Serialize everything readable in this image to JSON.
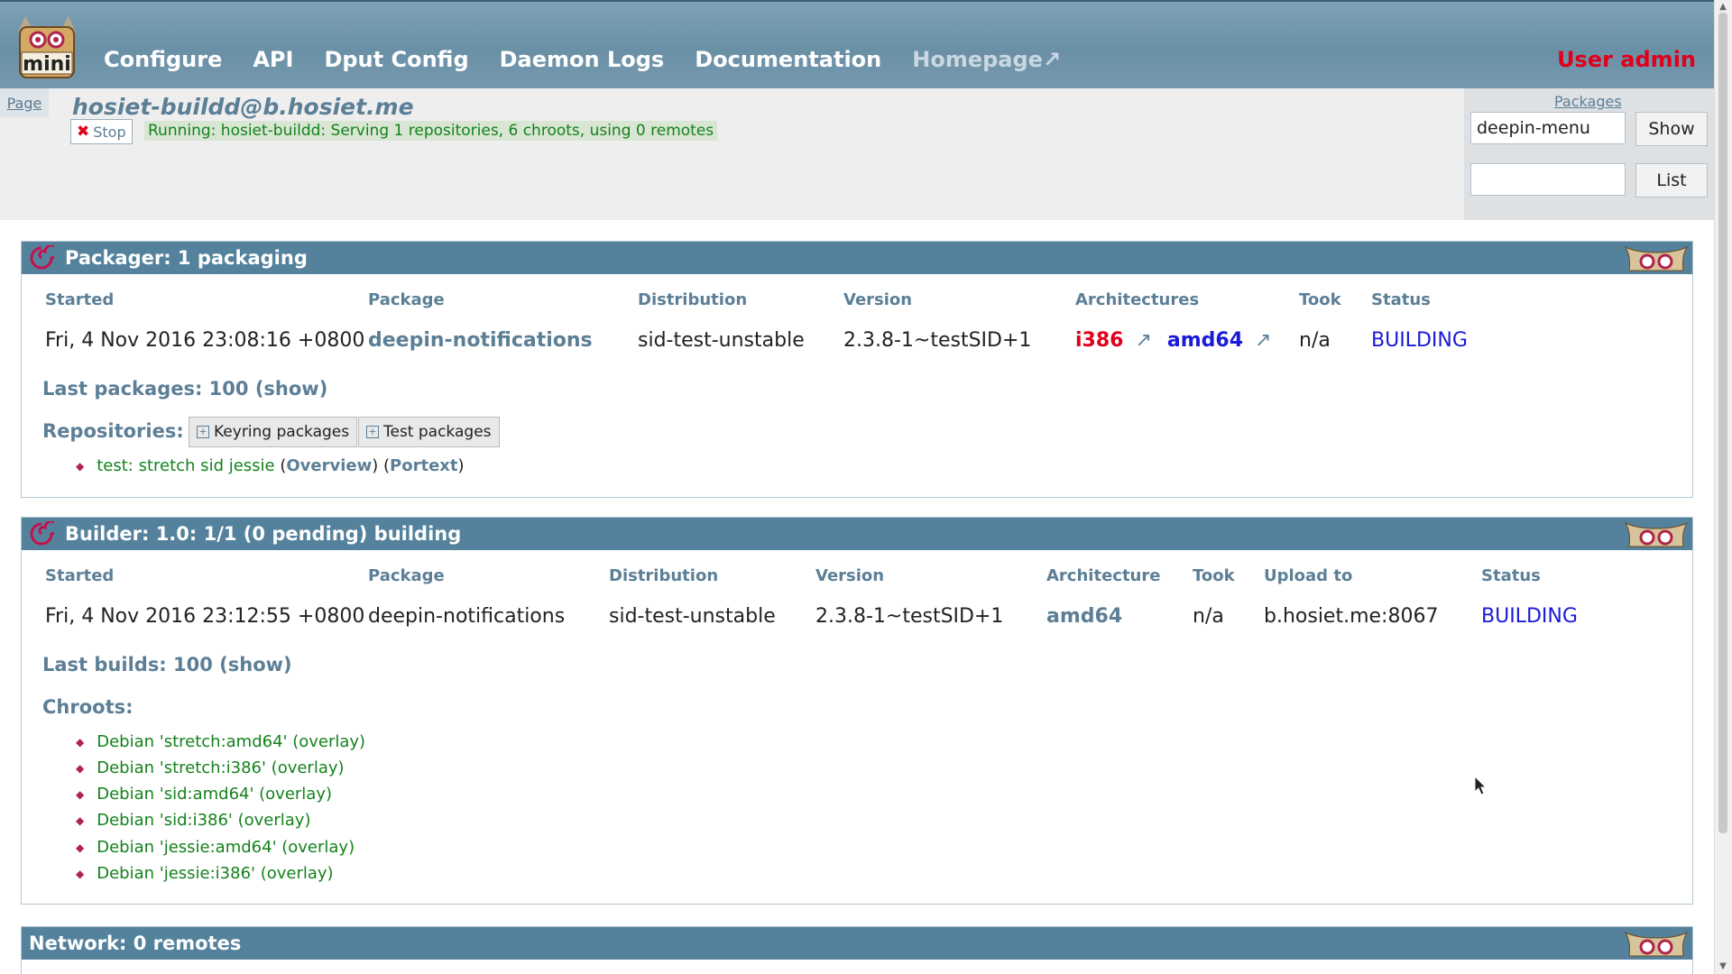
{
  "nav": {
    "items": [
      {
        "label": "Configure"
      },
      {
        "label": "API"
      },
      {
        "label": "Dput Config"
      },
      {
        "label": "Daemon Logs"
      },
      {
        "label": "Documentation"
      },
      {
        "label": "Homepage↗"
      }
    ],
    "user": "User admin",
    "logo_text": "mini"
  },
  "status": {
    "page_tab": "Page",
    "daemon": "hosiet-buildd@b.hosiet.me",
    "stop_label": "Stop",
    "running_text": "Running: hosiet-buildd: Serving 1 repositories, 6 chroots, using 0 remotes"
  },
  "side": {
    "title": "Packages",
    "search_value": "deepin-menu",
    "show_label": "Show",
    "list_value": "",
    "list_label": "List"
  },
  "packager": {
    "title": "Packager: 1 packaging",
    "headers": [
      "Started",
      "Package",
      "Distribution",
      "Version",
      "Architectures",
      "Took",
      "Status"
    ],
    "row": {
      "started": "Fri, 4 Nov 2016 23:08:16 +0800",
      "package": "deepin-notifications",
      "distribution": "sid-test-unstable",
      "version": "2.3.8-1~testSID+1",
      "arch1": "i386",
      "arch2": "amd64",
      "arrow": "↗",
      "took": "n/a",
      "status": "BUILDING"
    },
    "last_label": "Last packages: 100 (",
    "last_show": "show",
    "last_close": ")",
    "repos_label": "Repositories:",
    "repo_buttons": [
      "Keyring packages",
      "Test packages"
    ],
    "repo_item": "test: stretch sid jessie",
    "repo_overview": "Overview",
    "repo_portext": "Portext"
  },
  "builder": {
    "title": "Builder: 1.0: 1/1 (0 pending) building",
    "headers": [
      "Started",
      "Package",
      "Distribution",
      "Version",
      "Architecture",
      "Took",
      "Upload to",
      "Status"
    ],
    "row": {
      "started": "Fri, 4 Nov 2016 23:12:55 +0800",
      "package": "deepin-notifications",
      "distribution": "sid-test-unstable",
      "version": "2.3.8-1~testSID+1",
      "architecture": "amd64",
      "took": "n/a",
      "upload_to": "b.hosiet.me:8067",
      "status": "BUILDING"
    },
    "last_label": "Last builds: 100 (",
    "last_show": "show",
    "last_close": ")",
    "chroots_label": "Chroots:",
    "chroots": [
      "Debian 'stretch:amd64' (overlay)",
      "Debian 'stretch:i386' (overlay)",
      "Debian 'sid:amd64' (overlay)",
      "Debian 'sid:i386' (overlay)",
      "Debian 'jessie:amd64' (overlay)",
      "Debian 'jessie:i386' (overlay)"
    ]
  },
  "network": {
    "title": "Network: 0 remotes"
  },
  "icons": {
    "logo": "mini-buildd-logo",
    "section": "debian-swirl-icon",
    "mask": "mask-icon",
    "stop": "close-icon",
    "plus": "expand-icon"
  },
  "colors": {
    "topbar": "#6a90a6",
    "section_header": "#54829c",
    "link": "#5c7f96",
    "green": "#14821c",
    "red": "#e0001b",
    "blue": "#1a1ad8"
  }
}
